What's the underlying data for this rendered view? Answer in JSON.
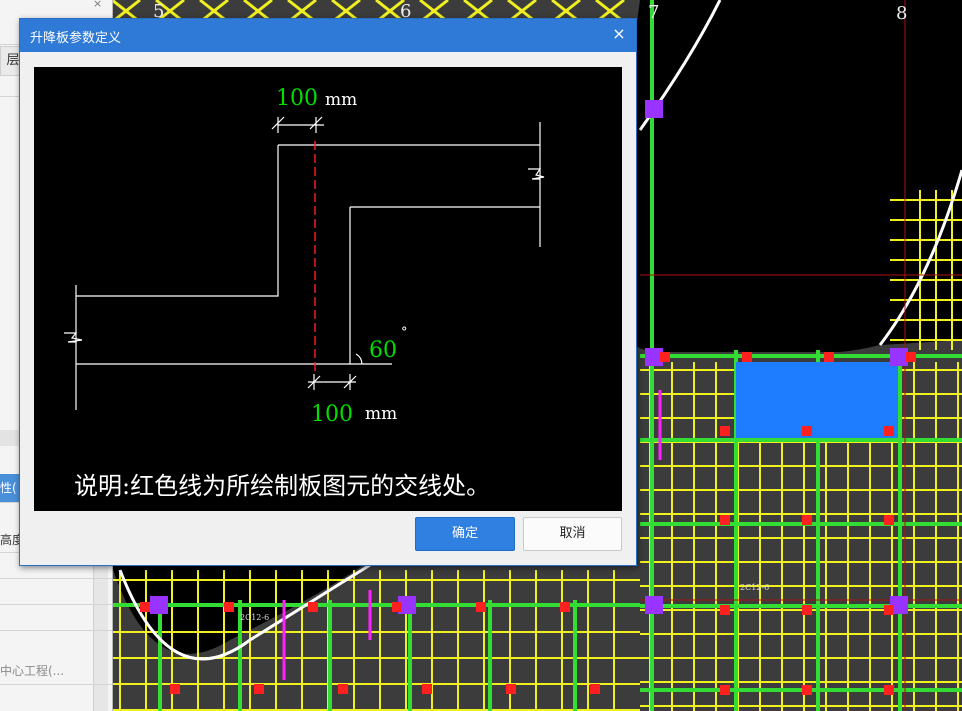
{
  "dialog": {
    "title": "升降板参数定义",
    "close_glyph": "×",
    "ok_label": "确定",
    "cancel_label": "取消"
  },
  "diagram": {
    "top_value": "100",
    "top_unit": "mm",
    "bottom_value": "100",
    "bottom_unit": "mm",
    "angle_value": "60",
    "angle_unit": "°",
    "note": "说明:红色线为所绘制板图元的交线处。"
  },
  "left_panel": {
    "close_glyph": "×",
    "tab_label": "层",
    "prop_label": "性(",
    "height_label": "高度",
    "project_label": "中心工程(..."
  },
  "cad": {
    "axis_labels": [
      "5",
      "6",
      "7",
      "8"
    ],
    "rebar_label": "2C12-6"
  },
  "colors": {
    "titlebar": "#2e7ad6",
    "dimension_text": "#00e000",
    "intersection_line": "#ff2020",
    "cad_green": "#33dd33",
    "cad_yellow": "#f0f020",
    "cad_red": "#ff2020",
    "cad_magenta": "#ff20ff",
    "cad_purple": "#9933ff",
    "cad_blue": "#1e7cff"
  }
}
